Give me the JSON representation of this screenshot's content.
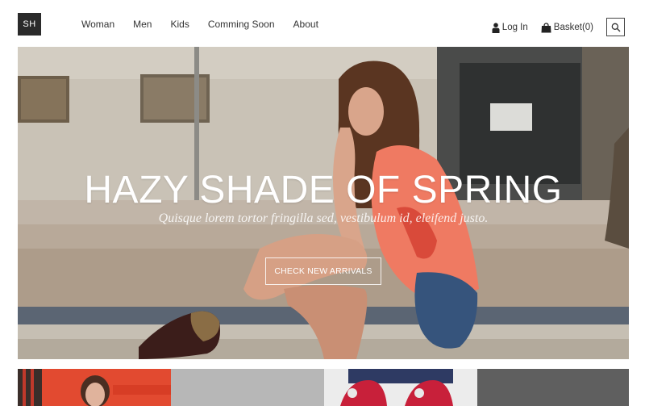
{
  "logo": {
    "text": "SH"
  },
  "nav": {
    "items": [
      {
        "label": "Woman"
      },
      {
        "label": "Men"
      },
      {
        "label": "Kids"
      },
      {
        "label": "Comming Soon"
      },
      {
        "label": "About"
      }
    ]
  },
  "user": {
    "login_label": "Log In",
    "basket_label": "Basket(0)",
    "login_icon": "user-icon",
    "basket_icon": "shopping-bag-icon",
    "search_icon": "search-icon"
  },
  "hero": {
    "title": "HAZY SHADE OF SPRING",
    "subtitle": "Quisque lorem tortor fringilla sed, vestibulum id, eleifend justo.",
    "button_label": "CHECK NEW ARRIVALS"
  },
  "colors": {
    "logo_bg": "#2a2a2a",
    "thumb_red": "#e5432c",
    "thumb_dark": "#5f5f5f"
  }
}
